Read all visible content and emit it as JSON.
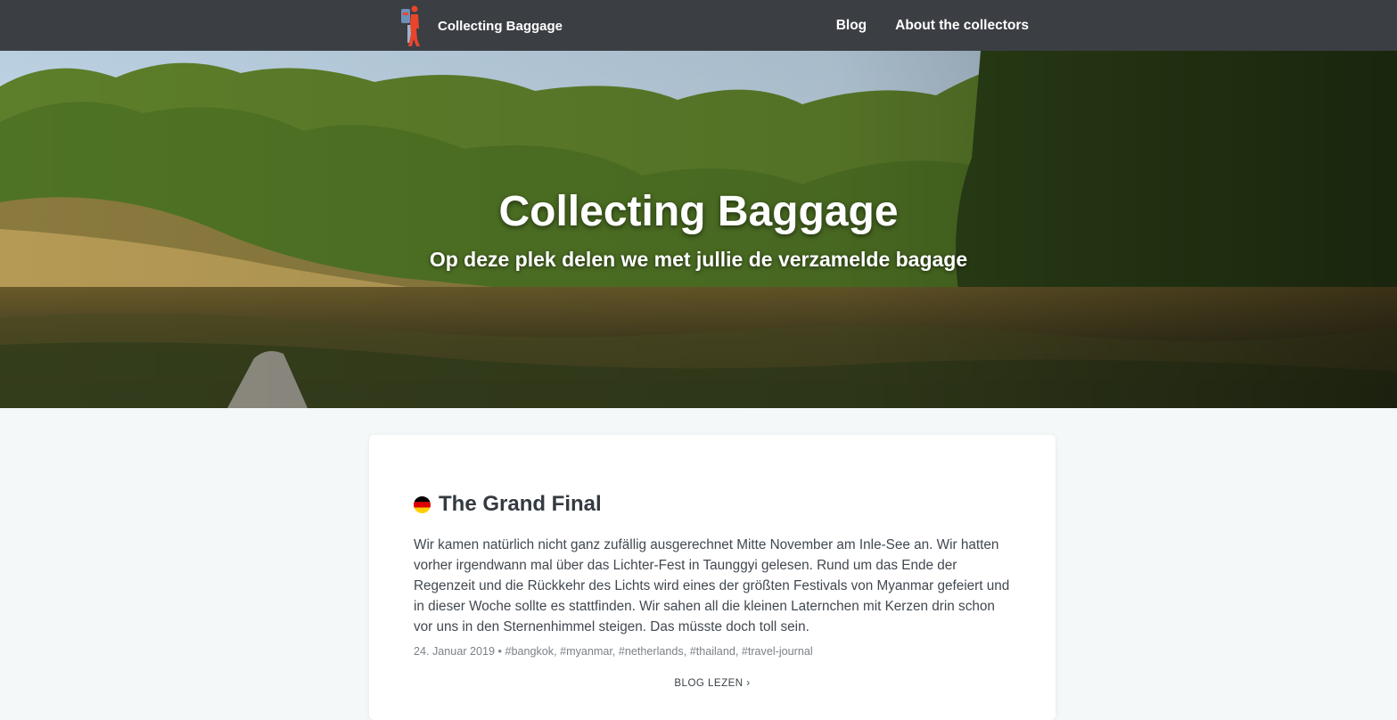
{
  "navbar": {
    "brand": "Collecting Baggage",
    "links": [
      {
        "label": "Blog"
      },
      {
        "label": "About the collectors"
      }
    ]
  },
  "hero": {
    "title": "Collecting Baggage",
    "subtitle": "Op deze plek delen we met jullie de verzamelde bagage"
  },
  "post": {
    "flag_icon": "germany-flag-icon",
    "title": "The Grand Final",
    "excerpt": "Wir kamen natürlich nicht ganz zufällig ausgerechnet Mitte November am Inle-See an. Wir hatten vorher irgendwann mal über das Lichter-Fest in Taunggyi gelesen. Rund um das Ende der Regenzeit und die Rückkehr des Lichts wird eines der größten Festivals von Myanmar gefeiert und in dieser Woche sollte es stattfinden. Wir sahen all die kleinen Laternchen mit Kerzen drin schon vor uns in den Sternenhimmel steigen. Das müsste doch toll sein.",
    "date": "24. Januar 2019",
    "separator": "•",
    "tags": [
      "#bangkok,",
      "#myanmar,",
      "#netherlands,",
      "#thailand,",
      "#travel-journal"
    ],
    "read_more": "BLOG LEZEN ›"
  },
  "colors": {
    "navbar_bg": "#3b3e43",
    "page_bg": "#f4f8f9",
    "logo_accent": "#e8452c"
  }
}
